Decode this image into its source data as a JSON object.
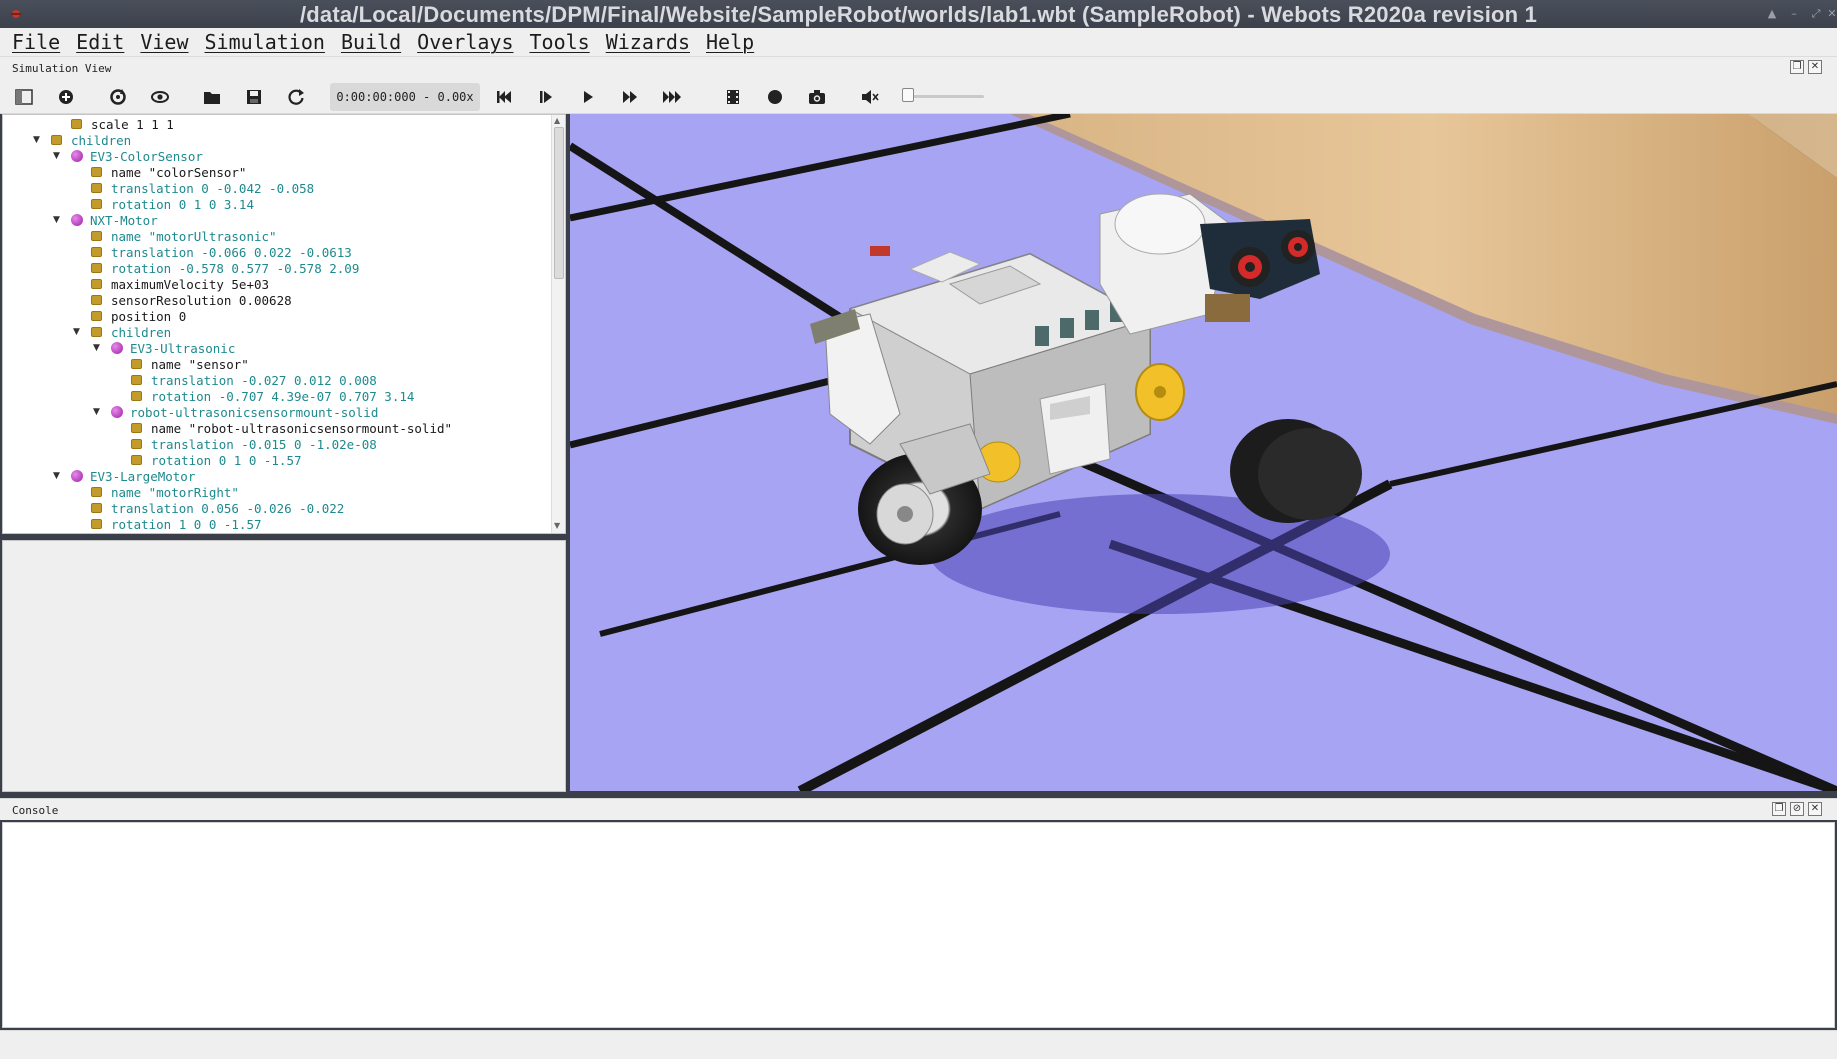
{
  "window": {
    "title": "/data/Local/Documents/DPM/Final/Website/SampleRobot/worlds/lab1.wbt (SampleRobot) - Webots R2020a revision 1"
  },
  "menu": [
    "File",
    "Edit",
    "View",
    "Simulation",
    "Build",
    "Overlays",
    "Tools",
    "Wizards",
    "Help"
  ],
  "simulation_view": {
    "label": "Simulation View"
  },
  "toolbar": {
    "time": "0:00:00:000 -  0.00x"
  },
  "scene_tree": [
    {
      "indent": 2,
      "kind": "field",
      "arrow": "",
      "text": "scale 1 1 1",
      "color": "black"
    },
    {
      "indent": 1,
      "kind": "field",
      "arrow": "open",
      "text": "children",
      "color": "teal"
    },
    {
      "indent": 2,
      "kind": "node",
      "arrow": "open",
      "text": "EV3-ColorSensor",
      "color": "teal"
    },
    {
      "indent": 3,
      "kind": "field",
      "arrow": "",
      "text": "name \"colorSensor\"",
      "color": "black"
    },
    {
      "indent": 3,
      "kind": "field",
      "arrow": "",
      "text": "translation 0 -0.042 -0.058",
      "color": "teal"
    },
    {
      "indent": 3,
      "kind": "field",
      "arrow": "",
      "text": "rotation 0 1 0 3.14",
      "color": "teal"
    },
    {
      "indent": 2,
      "kind": "node",
      "arrow": "open",
      "text": "NXT-Motor",
      "color": "teal"
    },
    {
      "indent": 3,
      "kind": "field",
      "arrow": "",
      "text": "name \"motorUltrasonic\"",
      "color": "teal"
    },
    {
      "indent": 3,
      "kind": "field",
      "arrow": "",
      "text": "translation -0.066 0.022 -0.0613",
      "color": "teal"
    },
    {
      "indent": 3,
      "kind": "field",
      "arrow": "",
      "text": "rotation -0.578 0.577 -0.578 2.09",
      "color": "teal"
    },
    {
      "indent": 3,
      "kind": "field",
      "arrow": "",
      "text": "maximumVelocity 5e+03",
      "color": "black"
    },
    {
      "indent": 3,
      "kind": "field",
      "arrow": "",
      "text": "sensorResolution 0.00628",
      "color": "black"
    },
    {
      "indent": 3,
      "kind": "field",
      "arrow": "",
      "text": "position 0",
      "color": "black"
    },
    {
      "indent": 3,
      "kind": "field",
      "arrow": "open",
      "text": "children",
      "color": "teal"
    },
    {
      "indent": 4,
      "kind": "node",
      "arrow": "open",
      "text": "EV3-Ultrasonic",
      "color": "teal"
    },
    {
      "indent": 5,
      "kind": "field",
      "arrow": "",
      "text": "name \"sensor\"",
      "color": "black"
    },
    {
      "indent": 5,
      "kind": "field",
      "arrow": "",
      "text": "translation -0.027 0.012 0.008",
      "color": "teal"
    },
    {
      "indent": 5,
      "kind": "field",
      "arrow": "",
      "text": "rotation -0.707 4.39e-07 0.707 3.14",
      "color": "teal"
    },
    {
      "indent": 4,
      "kind": "node",
      "arrow": "open",
      "text": "robot-ultrasonicsensormount-solid",
      "color": "teal"
    },
    {
      "indent": 5,
      "kind": "field",
      "arrow": "",
      "text": "name \"robot-ultrasonicsensormount-solid\"",
      "color": "black"
    },
    {
      "indent": 5,
      "kind": "field",
      "arrow": "",
      "text": "translation -0.015 0 -1.02e-08",
      "color": "teal"
    },
    {
      "indent": 5,
      "kind": "field",
      "arrow": "",
      "text": "rotation 0 1 0 -1.57",
      "color": "teal"
    },
    {
      "indent": 2,
      "kind": "node",
      "arrow": "open",
      "text": "EV3-LargeMotor",
      "color": "teal"
    },
    {
      "indent": 3,
      "kind": "field",
      "arrow": "",
      "text": "name \"motorRight\"",
      "color": "teal"
    },
    {
      "indent": 3,
      "kind": "field",
      "arrow": "",
      "text": "translation 0.056 -0.026 -0.022",
      "color": "teal"
    },
    {
      "indent": 3,
      "kind": "field",
      "arrow": "",
      "text": "rotation 1 0 0 -1.57",
      "color": "teal"
    }
  ],
  "console": {
    "label": "Console"
  },
  "colors": {
    "tree_teal": "#1e8a8e",
    "floor": "#a7a4f3",
    "field_icon": "#c39b2b",
    "node_icon": "#a01ea8"
  },
  "toolbar_icons": [
    "scene-tree-toggle-icon",
    "add-node-icon",
    "reload-icon",
    "view-icon",
    "open-world-icon",
    "save-world-icon",
    "reset-simulation-icon",
    "step-back-icon",
    "step-icon",
    "run-realtime-icon",
    "run-fast-icon",
    "run-fastest-icon",
    "make-movie-icon",
    "record-animation-icon",
    "screenshot-icon",
    "mute-icon"
  ]
}
